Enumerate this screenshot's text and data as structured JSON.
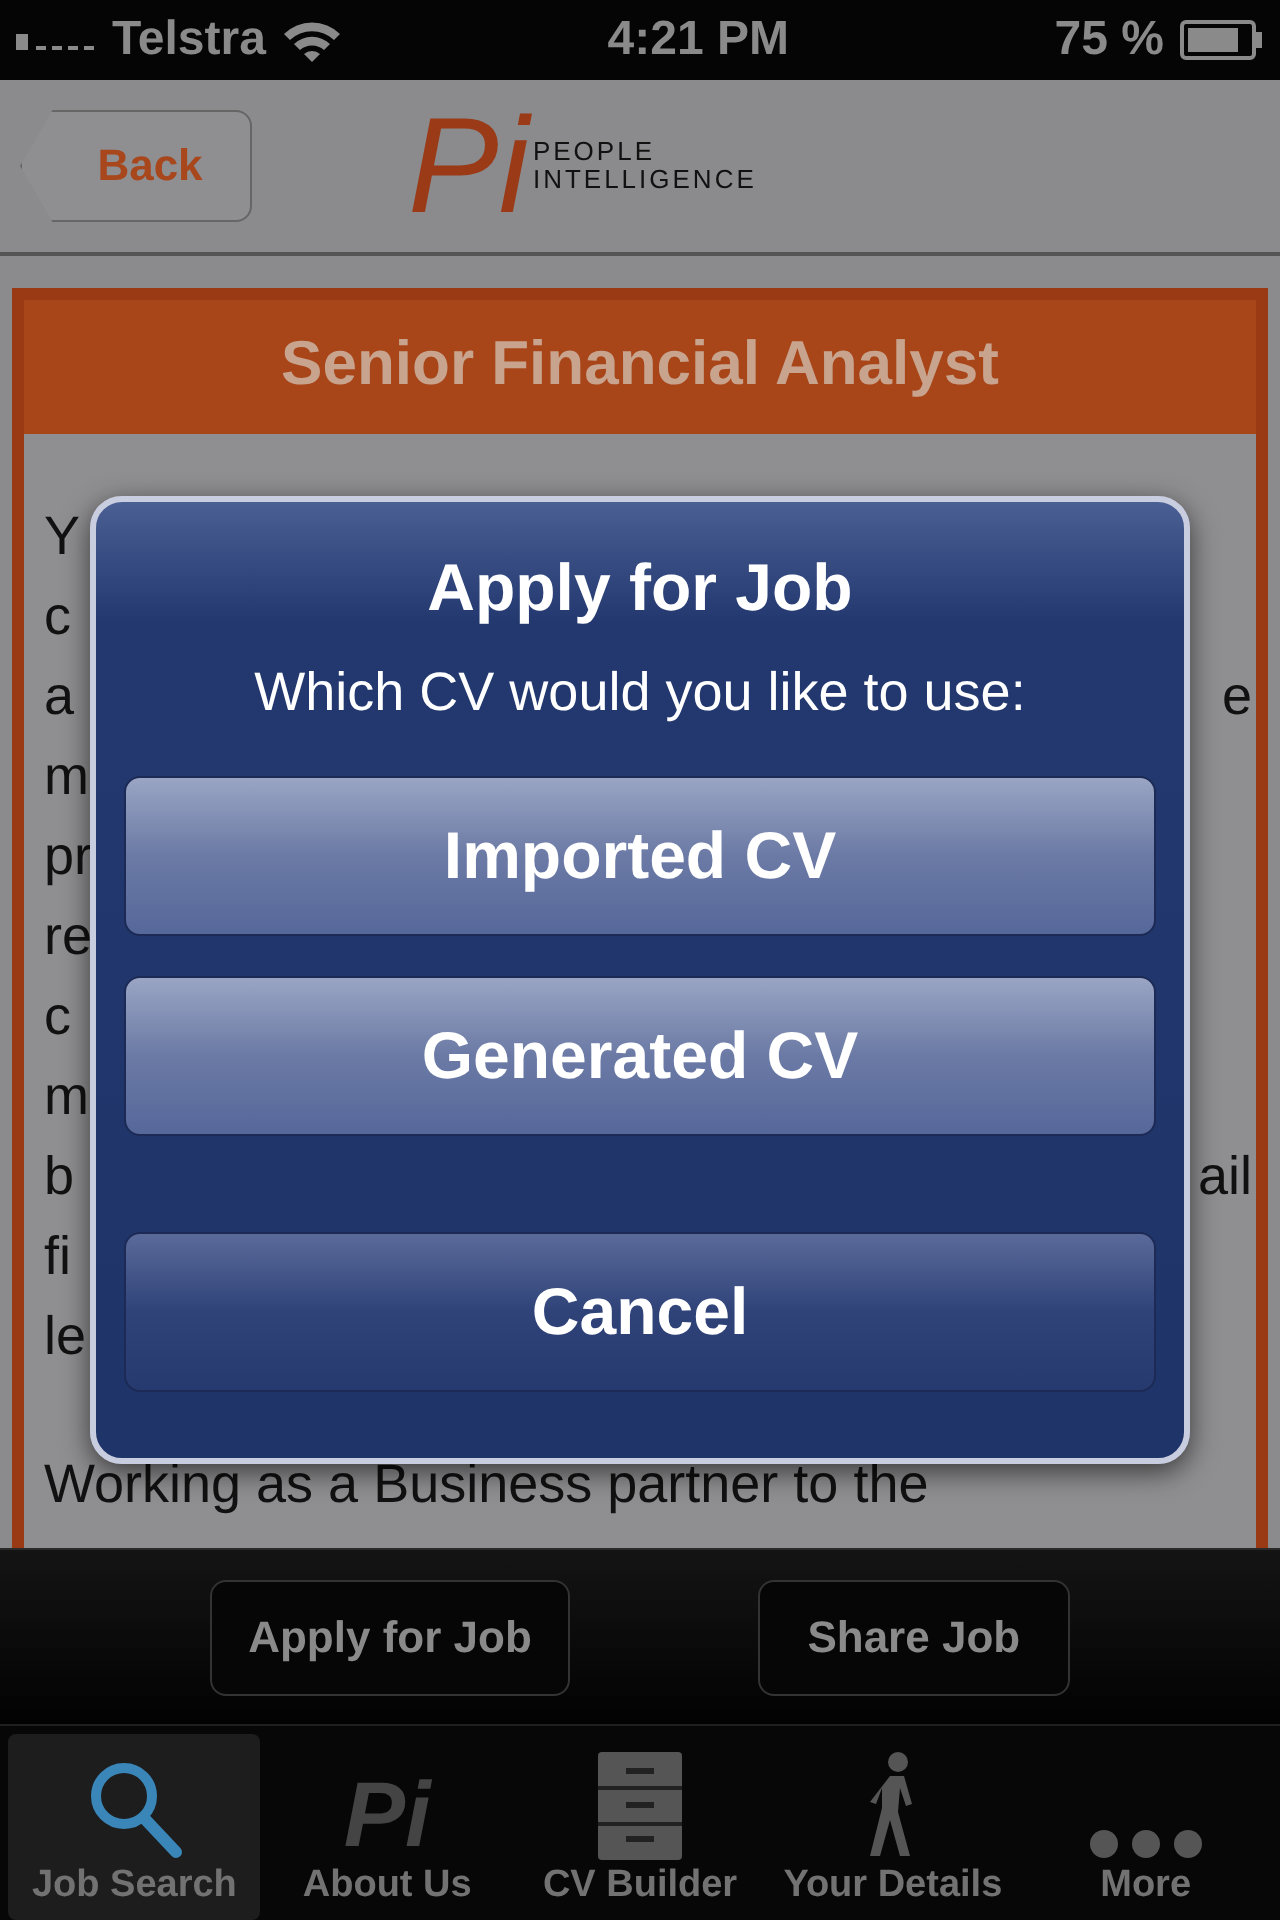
{
  "status_bar": {
    "carrier": "Telstra",
    "time": "4:21 PM",
    "battery": "75 %"
  },
  "nav_bar": {
    "back": "Back",
    "logo": {
      "mark": "Pi",
      "line_1": "PEOPLE",
      "line_2": "INTELLIGENCE"
    }
  },
  "job": {
    "title": "Senior Financial Analyst",
    "visible_lines": [
      {
        "left": "Y"
      },
      {
        "left": "c"
      },
      {
        "left": "a",
        "right": "e"
      },
      {
        "left": "m"
      },
      {
        "left": "pr"
      },
      {
        "left": "re"
      },
      {
        "left": "c"
      },
      {
        "left": "m"
      },
      {
        "left": "b",
        "right": "ail"
      },
      {
        "left": "fi"
      },
      {
        "left": "le"
      }
    ],
    "paragraph_2": "Working as a Business partner to the"
  },
  "alert": {
    "title": "Apply for Job",
    "message": "Which CV would you like to use:",
    "buttons": [
      {
        "label": "Imported CV",
        "kind": "option"
      },
      {
        "label": "Generated CV",
        "kind": "option"
      },
      {
        "label": "Cancel",
        "kind": "cancel"
      }
    ]
  },
  "toolbar": {
    "buttons": [
      "Apply for Job",
      "Share Job"
    ]
  },
  "tab_bar": [
    {
      "label": "Job Search",
      "kind": "search",
      "selected": true
    },
    {
      "label": "About Us",
      "kind": "logo",
      "icon_text": "Pi",
      "selected": false
    },
    {
      "label": "CV Builder",
      "kind": "cabinet",
      "selected": false
    },
    {
      "label": "Your Details",
      "kind": "walker",
      "selected": false
    },
    {
      "label": "More",
      "kind": "more",
      "selected": false
    }
  ]
}
